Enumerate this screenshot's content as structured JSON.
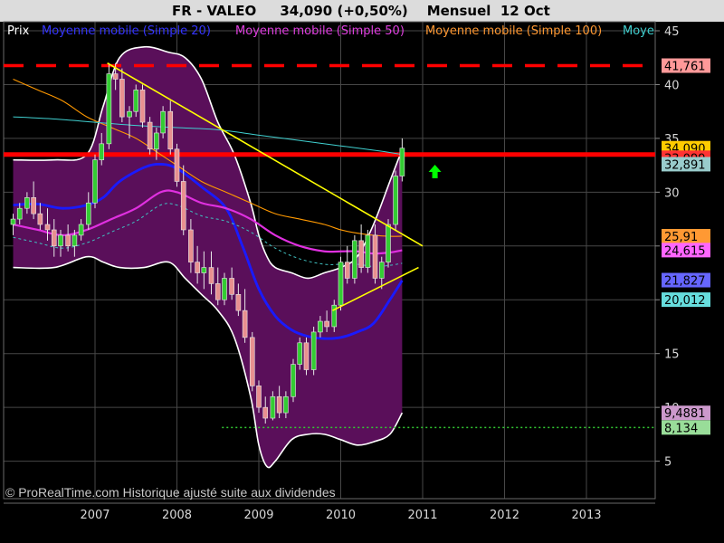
{
  "header": {
    "instrument": "FR - VALEO",
    "quote": "34,090 (+0,50%)",
    "period": "Mensuel",
    "date": "12 Oct"
  },
  "legend": {
    "price": "Prix",
    "ma20": "Moyenne mobile (Simple 20)",
    "ma50": "Moyenne mobile (Simple 50)",
    "ma100": "Moyenne mobile (Simple 100)",
    "ma200_truncated": "Moye"
  },
  "watermark": "© ProRealTime.com Historique ajusté suite aux dividendes",
  "colors": {
    "background": "#000000",
    "band_fill": "#5a0f5a",
    "up_candle": "#33cc33",
    "down_candle": "#e89090",
    "ma20": "#1a1aff",
    "ma50": "#e030e0",
    "ma100": "#ff9900",
    "ma200": "#40d0d0",
    "trendline": "#ffff00",
    "resistance": "#ff0000",
    "support": "#33cc33",
    "legend_price": "#ffffff",
    "legend_ma20": "#3030ff",
    "legend_ma50": "#e040e0",
    "legend_ma100": "#ff9933",
    "legend_ma200": "#40d0d0"
  },
  "chart_data": {
    "type": "candlestick",
    "title": "FR - VALEO 34,090 (+0,50%) Mensuel 12 Oct",
    "x_tick_labels": [
      "2007",
      "2008",
      "2009",
      "2010",
      "2011",
      "2012",
      "2013"
    ],
    "y_tick_labels": [
      "5",
      "10",
      "15",
      "20",
      "25",
      "30",
      "35",
      "40",
      "45"
    ],
    "ylim": [
      2,
      45
    ],
    "x_range": [
      2006.0,
      2013.8
    ],
    "grid": true,
    "candles": [
      {
        "t": 2006.0,
        "o": 27.0,
        "h": 28.0,
        "l": 26.0,
        "c": 27.5
      },
      {
        "t": 2006.08,
        "o": 27.5,
        "h": 29.0,
        "l": 27.0,
        "c": 28.5
      },
      {
        "t": 2006.17,
        "o": 28.5,
        "h": 30.0,
        "l": 28.0,
        "c": 29.5
      },
      {
        "t": 2006.25,
        "o": 29.5,
        "h": 31.0,
        "l": 27.5,
        "c": 28.0
      },
      {
        "t": 2006.33,
        "o": 28.0,
        "h": 29.0,
        "l": 26.5,
        "c": 27.0
      },
      {
        "t": 2006.42,
        "o": 27.0,
        "h": 28.5,
        "l": 25.5,
        "c": 26.5
      },
      {
        "t": 2006.5,
        "o": 26.5,
        "h": 27.5,
        "l": 24.0,
        "c": 25.0
      },
      {
        "t": 2006.58,
        "o": 25.0,
        "h": 26.5,
        "l": 24.0,
        "c": 26.0
      },
      {
        "t": 2006.67,
        "o": 26.0,
        "h": 27.0,
        "l": 24.5,
        "c": 25.0
      },
      {
        "t": 2006.75,
        "o": 25.0,
        "h": 26.5,
        "l": 24.0,
        "c": 26.0
      },
      {
        "t": 2006.83,
        "o": 26.0,
        "h": 27.5,
        "l": 25.5,
        "c": 27.0
      },
      {
        "t": 2006.92,
        "o": 27.0,
        "h": 30.0,
        "l": 26.5,
        "c": 29.0
      },
      {
        "t": 2007.0,
        "o": 29.0,
        "h": 33.5,
        "l": 28.5,
        "c": 33.0
      },
      {
        "t": 2007.08,
        "o": 33.0,
        "h": 35.5,
        "l": 32.5,
        "c": 34.5
      },
      {
        "t": 2007.17,
        "o": 34.5,
        "h": 42.0,
        "l": 34.0,
        "c": 41.0
      },
      {
        "t": 2007.25,
        "o": 41.0,
        "h": 42.0,
        "l": 39.5,
        "c": 40.5
      },
      {
        "t": 2007.33,
        "o": 40.5,
        "h": 41.5,
        "l": 36.5,
        "c": 37.0
      },
      {
        "t": 2007.42,
        "o": 37.0,
        "h": 38.0,
        "l": 35.0,
        "c": 37.5
      },
      {
        "t": 2007.5,
        "o": 37.5,
        "h": 40.0,
        "l": 37.0,
        "c": 39.5
      },
      {
        "t": 2007.58,
        "o": 39.5,
        "h": 40.0,
        "l": 36.0,
        "c": 36.5
      },
      {
        "t": 2007.67,
        "o": 36.5,
        "h": 37.0,
        "l": 33.5,
        "c": 34.0
      },
      {
        "t": 2007.75,
        "o": 34.0,
        "h": 36.0,
        "l": 33.0,
        "c": 35.5
      },
      {
        "t": 2007.83,
        "o": 35.5,
        "h": 38.0,
        "l": 35.0,
        "c": 37.5
      },
      {
        "t": 2007.92,
        "o": 37.5,
        "h": 38.5,
        "l": 33.5,
        "c": 34.0
      },
      {
        "t": 2008.0,
        "o": 34.0,
        "h": 34.5,
        "l": 30.5,
        "c": 31.0
      },
      {
        "t": 2008.08,
        "o": 31.0,
        "h": 32.5,
        "l": 26.0,
        "c": 26.5
      },
      {
        "t": 2008.17,
        "o": 26.5,
        "h": 27.5,
        "l": 22.5,
        "c": 23.5
      },
      {
        "t": 2008.25,
        "o": 23.5,
        "h": 25.0,
        "l": 21.5,
        "c": 22.5
      },
      {
        "t": 2008.33,
        "o": 22.5,
        "h": 24.5,
        "l": 21.0,
        "c": 23.0
      },
      {
        "t": 2008.42,
        "o": 23.0,
        "h": 24.5,
        "l": 20.5,
        "c": 21.5
      },
      {
        "t": 2008.5,
        "o": 21.5,
        "h": 23.0,
        "l": 19.5,
        "c": 20.0
      },
      {
        "t": 2008.58,
        "o": 20.0,
        "h": 22.5,
        "l": 19.5,
        "c": 22.0
      },
      {
        "t": 2008.67,
        "o": 22.0,
        "h": 23.0,
        "l": 20.0,
        "c": 20.5
      },
      {
        "t": 2008.75,
        "o": 20.5,
        "h": 21.5,
        "l": 18.5,
        "c": 19.0
      },
      {
        "t": 2008.83,
        "o": 19.0,
        "h": 21.0,
        "l": 16.0,
        "c": 16.5
      },
      {
        "t": 2008.92,
        "o": 16.5,
        "h": 17.0,
        "l": 11.5,
        "c": 12.0
      },
      {
        "t": 2009.0,
        "o": 12.0,
        "h": 12.5,
        "l": 9.5,
        "c": 10.0
      },
      {
        "t": 2009.08,
        "o": 10.0,
        "h": 11.0,
        "l": 8.5,
        "c": 9.0
      },
      {
        "t": 2009.17,
        "o": 9.0,
        "h": 11.5,
        "l": 8.8,
        "c": 11.0
      },
      {
        "t": 2009.25,
        "o": 11.0,
        "h": 12.0,
        "l": 9.0,
        "c": 9.5
      },
      {
        "t": 2009.33,
        "o": 9.5,
        "h": 11.5,
        "l": 9.0,
        "c": 11.0
      },
      {
        "t": 2009.42,
        "o": 11.0,
        "h": 14.5,
        "l": 10.5,
        "c": 14.0
      },
      {
        "t": 2009.5,
        "o": 14.0,
        "h": 16.5,
        "l": 13.5,
        "c": 16.0
      },
      {
        "t": 2009.58,
        "o": 16.0,
        "h": 16.5,
        "l": 13.0,
        "c": 13.5
      },
      {
        "t": 2009.67,
        "o": 13.5,
        "h": 17.5,
        "l": 13.0,
        "c": 17.0
      },
      {
        "t": 2009.75,
        "o": 17.0,
        "h": 18.5,
        "l": 16.5,
        "c": 18.0
      },
      {
        "t": 2009.83,
        "o": 18.0,
        "h": 19.0,
        "l": 17.0,
        "c": 17.5
      },
      {
        "t": 2009.92,
        "o": 17.5,
        "h": 20.0,
        "l": 17.0,
        "c": 19.5
      },
      {
        "t": 2010.0,
        "o": 19.5,
        "h": 24.0,
        "l": 19.0,
        "c": 23.5
      },
      {
        "t": 2010.08,
        "o": 23.5,
        "h": 25.0,
        "l": 21.5,
        "c": 22.0
      },
      {
        "t": 2010.17,
        "o": 22.0,
        "h": 26.0,
        "l": 21.5,
        "c": 25.5
      },
      {
        "t": 2010.25,
        "o": 25.5,
        "h": 27.0,
        "l": 22.5,
        "c": 23.0
      },
      {
        "t": 2010.33,
        "o": 23.0,
        "h": 26.5,
        "l": 22.5,
        "c": 26.0
      },
      {
        "t": 2010.42,
        "o": 26.0,
        "h": 27.0,
        "l": 21.5,
        "c": 22.0
      },
      {
        "t": 2010.5,
        "o": 22.0,
        "h": 24.0,
        "l": 21.0,
        "c": 23.5
      },
      {
        "t": 2010.58,
        "o": 23.5,
        "h": 27.5,
        "l": 23.0,
        "c": 27.0
      },
      {
        "t": 2010.67,
        "o": 27.0,
        "h": 32.0,
        "l": 26.5,
        "c": 31.5
      },
      {
        "t": 2010.75,
        "o": 31.5,
        "h": 35.0,
        "l": 31.0,
        "c": 34.09
      }
    ],
    "series": [
      {
        "name": "Moyenne mobile (Simple 20)",
        "x": [
          2006.0,
          2006.3,
          2006.6,
          2006.9,
          2007.1,
          2007.3,
          2007.6,
          2007.8,
          2008.0,
          2008.3,
          2008.6,
          2008.8,
          2009.0,
          2009.2,
          2009.4,
          2009.6,
          2009.8,
          2010.0,
          2010.2,
          2010.4,
          2010.6,
          2010.75
        ],
        "y": [
          28.8,
          28.9,
          28.5,
          28.8,
          29.5,
          31.0,
          32.3,
          32.6,
          32.2,
          30.5,
          28.5,
          25.0,
          21.0,
          18.5,
          17.2,
          16.6,
          16.4,
          16.5,
          17.0,
          17.8,
          20.0,
          21.8
        ]
      },
      {
        "name": "Moyenne mobile (Simple 50)",
        "x": [
          2006.0,
          2006.3,
          2006.6,
          2006.9,
          2007.2,
          2007.5,
          2007.8,
          2008.0,
          2008.3,
          2008.6,
          2008.9,
          2009.2,
          2009.5,
          2009.8,
          2010.0,
          2010.2,
          2010.4,
          2010.6,
          2010.75
        ],
        "y": [
          27.0,
          26.5,
          26.0,
          26.5,
          27.5,
          28.5,
          30.0,
          30.0,
          29.0,
          28.5,
          27.5,
          26.0,
          25.0,
          24.5,
          24.5,
          24.5,
          24.3,
          24.4,
          24.6
        ]
      },
      {
        "name": "Moyenne mobile (Simple 100)",
        "x": [
          2006.0,
          2006.3,
          2006.6,
          2006.9,
          2007.2,
          2007.5,
          2007.8,
          2008.0,
          2008.3,
          2008.6,
          2008.9,
          2009.2,
          2009.5,
          2009.8,
          2010.0,
          2010.2,
          2010.4,
          2010.6,
          2010.75
        ],
        "y": [
          40.5,
          39.5,
          38.5,
          37.0,
          36.0,
          35.0,
          33.5,
          32.5,
          31.0,
          30.0,
          29.0,
          28.0,
          27.5,
          27.0,
          26.5,
          26.2,
          26.0,
          25.9,
          25.91
        ]
      },
      {
        "name": "Moye",
        "x": [
          2006.0,
          2006.5,
          2007.0,
          2007.5,
          2008.0,
          2008.5,
          2009.0,
          2009.5,
          2010.0,
          2010.5,
          2010.75
        ],
        "y": [
          37.0,
          36.8,
          36.5,
          36.2,
          36.0,
          35.8,
          35.3,
          34.8,
          34.3,
          33.8,
          33.5
        ]
      }
    ],
    "bands": {
      "x": [
        2006.0,
        2006.5,
        2006.9,
        2007.1,
        2007.3,
        2007.6,
        2007.9,
        2008.1,
        2008.3,
        2008.5,
        2008.7,
        2008.9,
        2009.0,
        2009.1,
        2009.2,
        2009.4,
        2009.6,
        2009.8,
        2010.0,
        2010.2,
        2010.4,
        2010.6,
        2010.75
      ],
      "upper": [
        33.0,
        33.0,
        33.5,
        38.0,
        42.5,
        43.5,
        43.0,
        42.5,
        40.5,
        36.5,
        33.5,
        29.0,
        26.0,
        24.0,
        23.0,
        22.5,
        22.0,
        22.5,
        23.0,
        24.0,
        27.0,
        31.0,
        34.0
      ],
      "lower": [
        23.0,
        23.0,
        24.0,
        23.5,
        23.0,
        23.0,
        23.5,
        22.0,
        20.5,
        19.0,
        16.5,
        11.0,
        6.5,
        4.5,
        5.0,
        7.0,
        7.5,
        7.5,
        7.0,
        6.5,
        6.8,
        7.5,
        9.5
      ]
    },
    "trendlines": [
      {
        "name": "resistance-trendline",
        "x": [
          2007.15,
          2011.0
        ],
        "y": [
          42.0,
          25.0
        ]
      },
      {
        "name": "support-trendline",
        "x": [
          2009.9,
          2010.95
        ],
        "y": [
          19.0,
          23.0
        ]
      }
    ],
    "horizontal_lines": [
      {
        "name": "dashed-resistance",
        "y": 41.761,
        "style": "dashed",
        "color": "#ff0000"
      },
      {
        "name": "solid-resistance",
        "y": 33.5,
        "style": "solid",
        "color": "#ff0000"
      },
      {
        "name": "dotted-support",
        "y": 8.134,
        "style": "dotted",
        "x_start": 2008.55,
        "color": "#33cc33"
      }
    ],
    "price_tags": [
      {
        "label": "41,761",
        "y": 41.761,
        "bg": "#ff9999",
        "fg": "#000000"
      },
      {
        "label": "34,090",
        "y": 34.09,
        "bg": "#ffcc00",
        "fg": "#000000"
      },
      {
        "label": "33,099",
        "y": 33.2,
        "bg": "#ff3333",
        "fg": "#000000"
      },
      {
        "label": "32,891",
        "y": 32.6,
        "bg": "#99cccc",
        "fg": "#000000"
      },
      {
        "label": "25,91",
        "y": 25.91,
        "bg": "#ff9933",
        "fg": "#000000"
      },
      {
        "label": "24,615",
        "y": 24.615,
        "bg": "#ff66ff",
        "fg": "#000000"
      },
      {
        "label": "21,827",
        "y": 21.827,
        "bg": "#6666ff",
        "fg": "#000000"
      },
      {
        "label": "20,012",
        "y": 20.012,
        "bg": "#66dddd",
        "fg": "#000000"
      },
      {
        "label": "9,4881",
        "y": 9.4881,
        "bg": "#cc99cc",
        "fg": "#000000"
      },
      {
        "label": "8,134",
        "y": 8.134,
        "bg": "#99dd99",
        "fg": "#000000"
      }
    ],
    "arrow": {
      "name": "buy-signal-arrow",
      "t": 2011.15,
      "y": 31.8,
      "color": "#00ff00"
    }
  }
}
